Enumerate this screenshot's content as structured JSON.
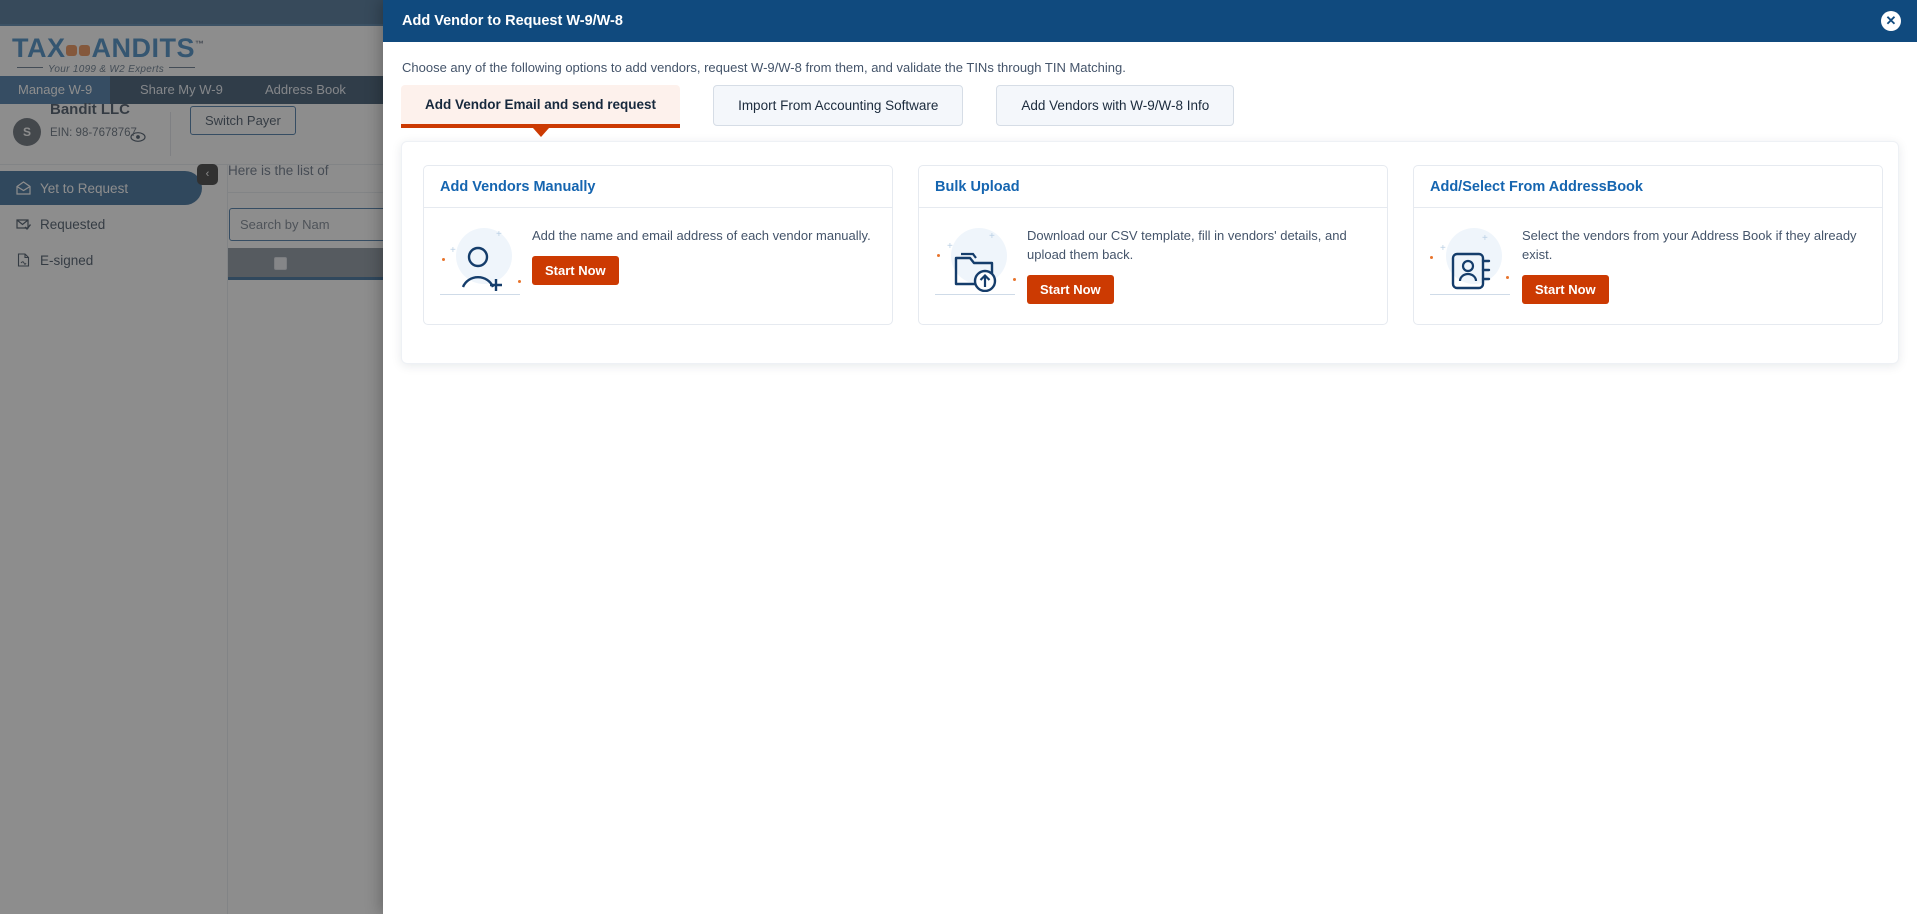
{
  "app": {
    "logo": {
      "text_left": "TAX",
      "text_right": "ANDITS",
      "trademark": "™",
      "tagline": "Your 1099 & W2 Experts"
    },
    "nav": [
      {
        "label": "Manage W-9",
        "active": true
      },
      {
        "label": "Share My W-9",
        "active": false
      },
      {
        "label": "Address Book",
        "active": false
      }
    ],
    "payer": {
      "avatar_initial": "S",
      "name": "Bandit LLC",
      "ein": "EIN: 98-7678767",
      "switch_payer_label": "Switch Payer"
    },
    "sidebar": {
      "items": [
        {
          "label": "Yet to Request",
          "icon": "envelope-open-icon",
          "active": true
        },
        {
          "label": "Requested",
          "icon": "envelope-check-icon",
          "active": false
        },
        {
          "label": "E-signed",
          "icon": "document-signed-icon",
          "active": false
        }
      ]
    },
    "content": {
      "heading": "Here is the list of",
      "search_placeholder": "Search by Nam",
      "collapse_label": "‹"
    }
  },
  "modal": {
    "title": "Add Vendor to Request W-9/W-8",
    "close_label": "✕",
    "subtitle": "Choose any of the following options to add vendors, request W-9/W-8 from them, and validate the TINs through TIN Matching.",
    "tabs": [
      {
        "label": "Add Vendor Email and send request",
        "active": true
      },
      {
        "label": "Import From Accounting Software",
        "active": false
      },
      {
        "label": "Add Vendors with W-9/W-8 Info",
        "active": false
      }
    ],
    "cards": [
      {
        "title": "Add Vendors Manually",
        "description": "Add the name and email address of each vendor manually.",
        "button_label": "Start Now",
        "icon": "user-plus-icon"
      },
      {
        "title": "Bulk Upload",
        "description": "Download our CSV template, fill in vendors' details, and upload them back.",
        "button_label": "Start Now",
        "icon": "folder-upload-icon"
      },
      {
        "title": "Add/Select From AddressBook",
        "description": "Select the vendors from your Address Book if they already exist.",
        "button_label": "Start Now",
        "icon": "address-book-icon"
      }
    ]
  },
  "colors": {
    "brand_blue": "#104a7e",
    "nav_dark": "#0c2d4d",
    "accent_orange": "#cc3a02",
    "tab_active_bg": "#fdf1ec",
    "card_title_blue": "#1565b0",
    "logo_blue": "#1a6fb5",
    "logo_orange": "#e8742c"
  }
}
